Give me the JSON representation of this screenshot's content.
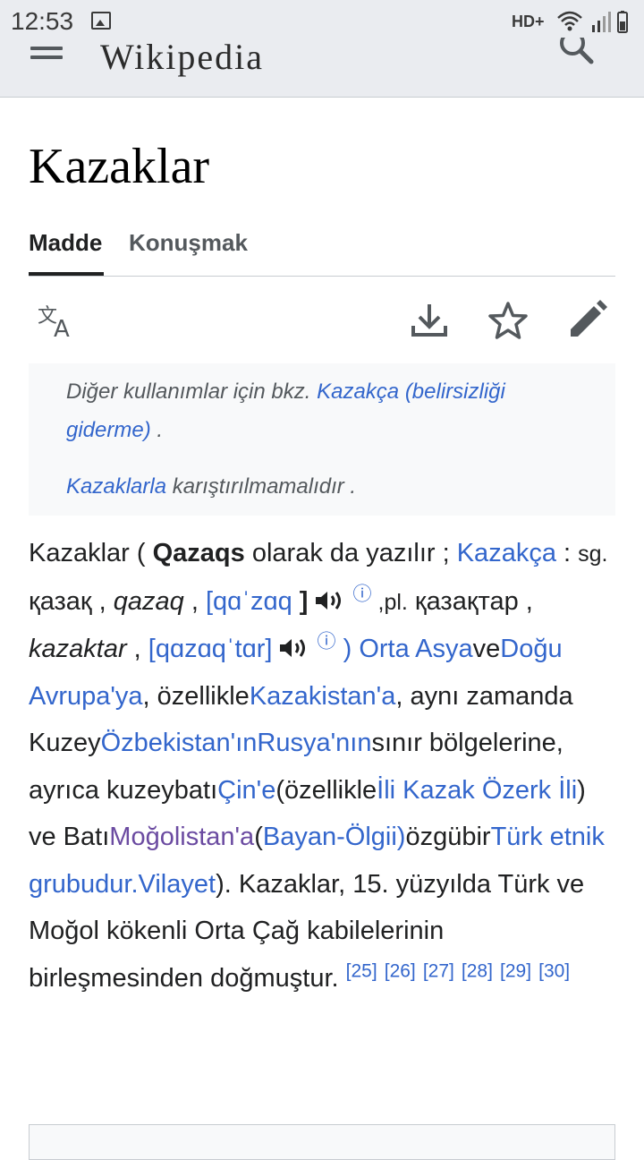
{
  "status_bar": {
    "time": "12:53",
    "network": "HD+",
    "icons": [
      "gallery-icon",
      "wifi-icon",
      "signal-icon",
      "battery-icon"
    ]
  },
  "toolbar": {
    "wordmark": "Wikipedia",
    "icons": [
      "menu-icon",
      "search-icon"
    ]
  },
  "article": {
    "title": "Kazaklar",
    "tabs": [
      {
        "label": "Madde",
        "active": true
      },
      {
        "label": "Konuşmak",
        "active": false
      }
    ],
    "actions": [
      "language-icon",
      "download-icon",
      "star-icon",
      "edit-icon"
    ]
  },
  "hatnote": {
    "line1_prefix": "Diğer kullanımlar için bkz.",
    "line1_link": "Kazakça (belirsizliği giderme)",
    "line1_suffix": ".",
    "line2_link": "Kazaklarla",
    "line2_suffix": "karıştırılmamalıdır ."
  },
  "paragraph": {
    "t1": "Kazaklar ( ",
    "bold": "Qazaqs",
    "t2": " olarak da yazılır ; ",
    "l_kazakca": "Kazakça",
    "t3": " : ",
    "sg": "sg.",
    "t4": " қазақ , ",
    "qazaq": "qazaq",
    "t5": " , ",
    "ipa1": "[qɑˈzɑq",
    "bracket": " ]",
    "info1": "ⓘ",
    "pl": " ,pl.",
    "t6": " қазақтар , ",
    "kazaktar": "kazaktar",
    "t7": " , ",
    "ipa2": "[qɑzɑqˈtɑr]",
    "info2": "ⓘ",
    "t8": " ",
    "l_orta": ") Orta Asya",
    "t_ve": "ve",
    "l_dogu": "Doğu Avrupa'ya",
    "t9": ", özellikle",
    "l_kazakistan": "Kazakistan'a",
    "t10": ", aynı zamanda Kuzey",
    "l_ozbek": "Özbekistan'ın",
    "l_rusya": "Rusya'nın",
    "t11": "sınır bölgelerine, ayrıca kuzeybatı",
    "l_cin": "Çin'e",
    "t12": "(özellikle",
    "l_ili": "İli Kazak Özerk İli",
    "t13": ") ve Batı",
    "l_mogol": "Moğolistan'a",
    "t14": "(",
    "l_bayan": "Bayan-Ölgii)",
    "t15": "özgübir",
    "l_turk": "Türk etnik grubudur.",
    "l_vilayet": "Vilayet",
    "t16": "). Kazaklar, 15. yüzyılda Türk ve Moğol kökenli Orta Çağ kabilelerinin birleşmesinden doğmuştur.",
    "refs": [
      "[25]",
      "[26]",
      "[27]",
      "[28]",
      "[29]",
      "[30]"
    ]
  },
  "colors": {
    "link": "#3366cc",
    "visited_link": "#6b4ba1",
    "chrome": "#eaecf0",
    "text": "#202122"
  }
}
